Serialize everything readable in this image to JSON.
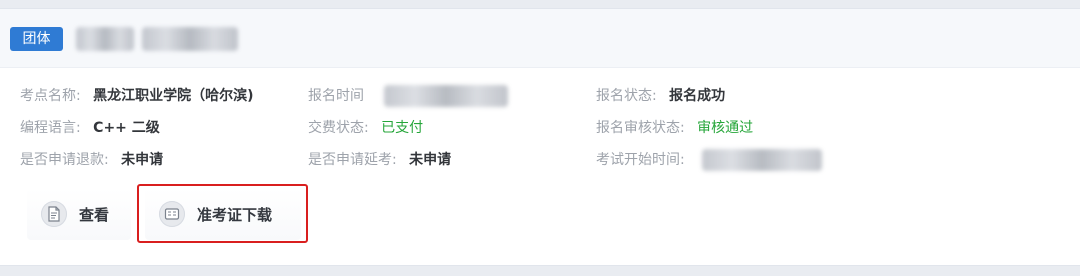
{
  "header": {
    "badge": "团体"
  },
  "fields": {
    "exam_site_label": "考点名称:",
    "exam_site_value": "黑龙江职业学院（哈尔滨)",
    "signup_time_label": "报名时间",
    "signup_status_label": "报名状态:",
    "signup_status_value": "报名成功",
    "language_label": "编程语言:",
    "language_value": "C++ 二级",
    "payment_status_label": "交费状态:",
    "payment_status_value": "已支付",
    "review_status_label": "报名审核状态:",
    "review_status_value": "审核通过",
    "refund_label": "是否申请退款:",
    "refund_value": "未申请",
    "delay_label": "是否申请延考:",
    "delay_value": "未申请",
    "exam_start_label": "考试开始时间:"
  },
  "actions": {
    "view_label": "查看",
    "download_label": "准考证下载"
  },
  "colors": {
    "badge": "#2f7bd4",
    "success": "#26a63a",
    "highlight": "#d91f1f"
  },
  "icons": {
    "view": "document-icon",
    "download": "ticket-icon"
  }
}
